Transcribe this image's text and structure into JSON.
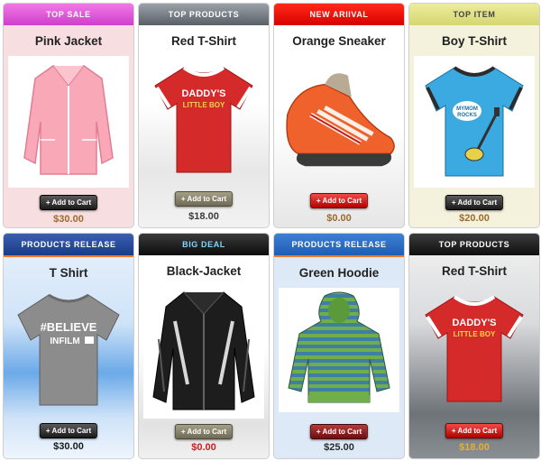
{
  "cart_label": "Add to Cart",
  "cards": [
    {
      "banner": "TOP SALE",
      "name": "Pink Jacket",
      "price": "$30.00",
      "cart_style": "dark",
      "price_color": "#9c6a2a",
      "icon": "pink-jacket-image"
    },
    {
      "banner": "TOP PRODUCTS",
      "name": "Red T-Shirt",
      "price": "$18.00",
      "cart_style": "olive",
      "price_color": "#3b3b3b",
      "icon": "red-tshirt-image"
    },
    {
      "banner": "NEW ARIIVAL",
      "name": "Orange Sneaker",
      "price": "$0.00",
      "cart_style": "red",
      "price_color": "#9c6a2a",
      "icon": "orange-sneaker-image"
    },
    {
      "banner": "TOP ITEM",
      "name": "Boy T-Shirt",
      "price": "$20.00",
      "cart_style": "dark",
      "price_color": "#9c6a2a",
      "icon": "boy-tshirt-image"
    },
    {
      "banner": "PRODUCTS RELEASE",
      "name": "T Shirt",
      "price": "$30.00",
      "cart_style": "dark",
      "price_color": "#1a1a1a",
      "icon": "grey-tshirt-image"
    },
    {
      "banner": "BIG DEAL",
      "name": "Black-Jacket",
      "price": "$0.00",
      "cart_style": "olive",
      "price_color": "#c82020",
      "icon": "black-jacket-image"
    },
    {
      "banner": "PRODUCTS RELEASE",
      "name": "Green Hoodie",
      "price": "$25.00",
      "cart_style": "maroon",
      "price_color": "#2a2a2a",
      "icon": "green-hoodie-image"
    },
    {
      "banner": "TOP PRODUCTS",
      "name": "Red T-Shirt",
      "price": "$18.00",
      "cart_style": "red",
      "price_color": "#e0b030",
      "icon": "red-tshirt-image"
    }
  ],
  "shirt_print": {
    "line1": "DADDY'S",
    "line2": "LITTLE BOY"
  },
  "boy_shirt_print": {
    "line1": "MYMOM",
    "line2": "ROCKS"
  },
  "grey_shirt_print": {
    "line1": "#BELIEVE",
    "line2": "INFILM"
  }
}
